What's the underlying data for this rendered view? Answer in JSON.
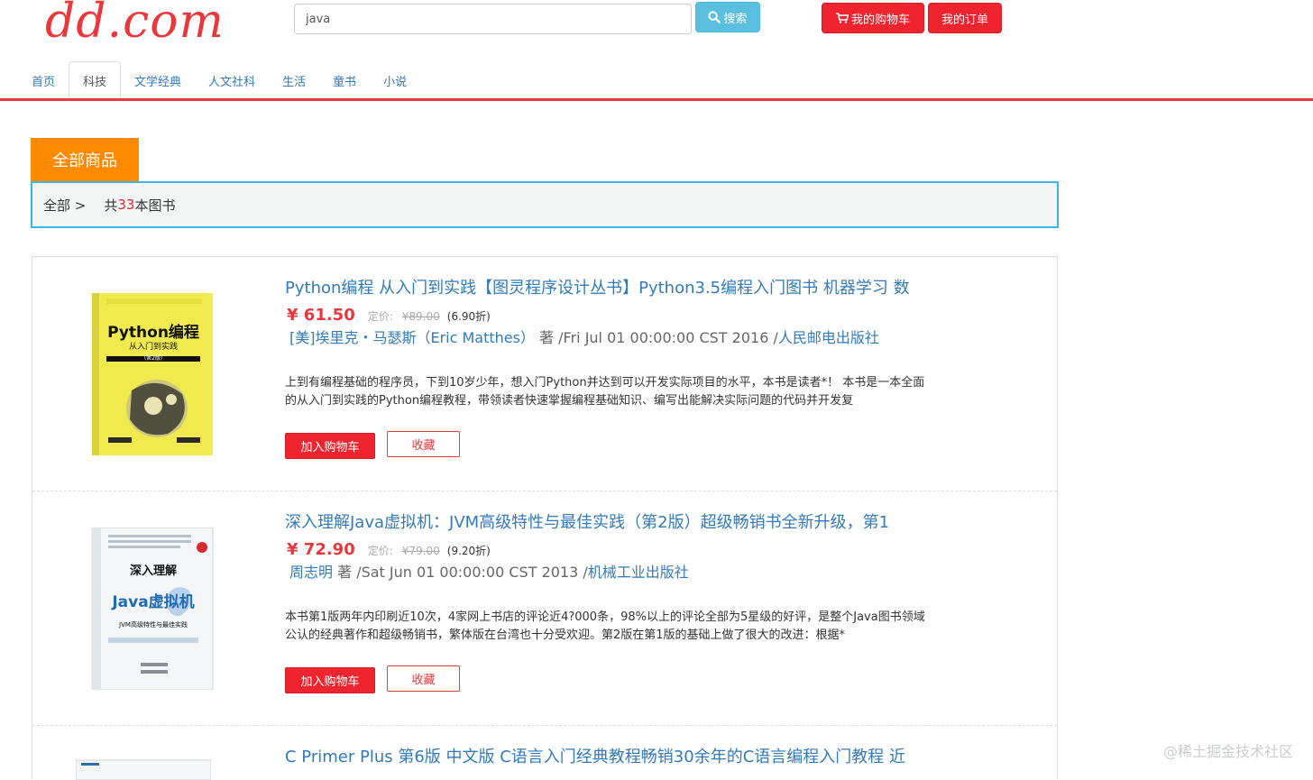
{
  "header": {
    "logo": "dd.com",
    "search_value": "java",
    "search_button": "搜索",
    "cart_button": "我的购物车",
    "orders_button": "我的订单"
  },
  "nav": {
    "tabs": [
      {
        "label": "首页",
        "active": false
      },
      {
        "label": "科技",
        "active": true
      },
      {
        "label": "文学经典",
        "active": false
      },
      {
        "label": "人文社科",
        "active": false
      },
      {
        "label": "生活",
        "active": false
      },
      {
        "label": "童书",
        "active": false
      },
      {
        "label": "小说",
        "active": false
      }
    ]
  },
  "category": {
    "tab_label": "全部商品",
    "breadcrumb_all": "全部 >",
    "count_prefix": "共",
    "count": "33",
    "count_suffix": "本图书"
  },
  "products": [
    {
      "title": "Python编程 从入门到实践【图灵程序设计丛书】Python3.5编程入门图书 机器学习 数",
      "price": "¥ 61.50",
      "list_label": "定价:",
      "list_price": "¥89.00",
      "discount": "(6.90折)",
      "author": "[美]埃里克・马瑟斯（Eric Matthes）",
      "author_suffix": " 著 /Fri Jul 01 00:00:00 CST 2016 /",
      "publisher": "人民邮电出版社",
      "description": "上到有编程基础的程序员，下到10岁少年，想入门Python并达到可以开发实际项目的水平，本书是读者*！ 本书是一本全面的从入门到实践的Python编程教程，带领读者快速掌握编程基础知识、编写出能解决实际问题的代码并开发复",
      "add_button": "加入购物车",
      "fav_button": "收藏",
      "cover_title": "Python编程",
      "cover_subtitle": "从入门到实践",
      "cover_edition": "（第2版）"
    },
    {
      "title": "深入理解Java虚拟机：JVM高级特性与最佳实践（第2版）超级畅销书全新升级，第1",
      "price": "¥ 72.90",
      "list_label": "定价:",
      "list_price": "¥79.00",
      "discount": "(9.20折)",
      "author": "周志明",
      "author_suffix": " 著 /Sat Jun 01 00:00:00 CST 2013 /",
      "publisher": "机械工业出版社",
      "description": "本书第1版两年内印刷近10次，4家网上书店的评论近4?000条，98%以上的评论全部为5星级的好评，是整个Java图书领域公认的经典著作和超级畅销书，繁体版在台湾也十分受欢迎。第2版在第1版的基础上做了很大的改进：根据*",
      "add_button": "加入购物车",
      "fav_button": "收藏",
      "cover_title": "深入理解",
      "cover_subtitle": "Java虚拟机",
      "cover_edition": "JVM高级特性与最佳实践"
    },
    {
      "title": "C Primer Plus 第6版 中文版 C语言入门经典教程畅销30余年的C语言编程入门教程 近"
    }
  ],
  "watermark": "@稀土掘金技术社区",
  "colors": {
    "brand_red": "#e8383d",
    "button_red": "#f0242f",
    "search_blue": "#5bc0de",
    "category_orange": "#ff8a00",
    "link_blue": "#337ab7",
    "crumb_border": "#3cb4e6"
  },
  "icons": {
    "search": "search-icon",
    "cart": "cart-icon"
  }
}
